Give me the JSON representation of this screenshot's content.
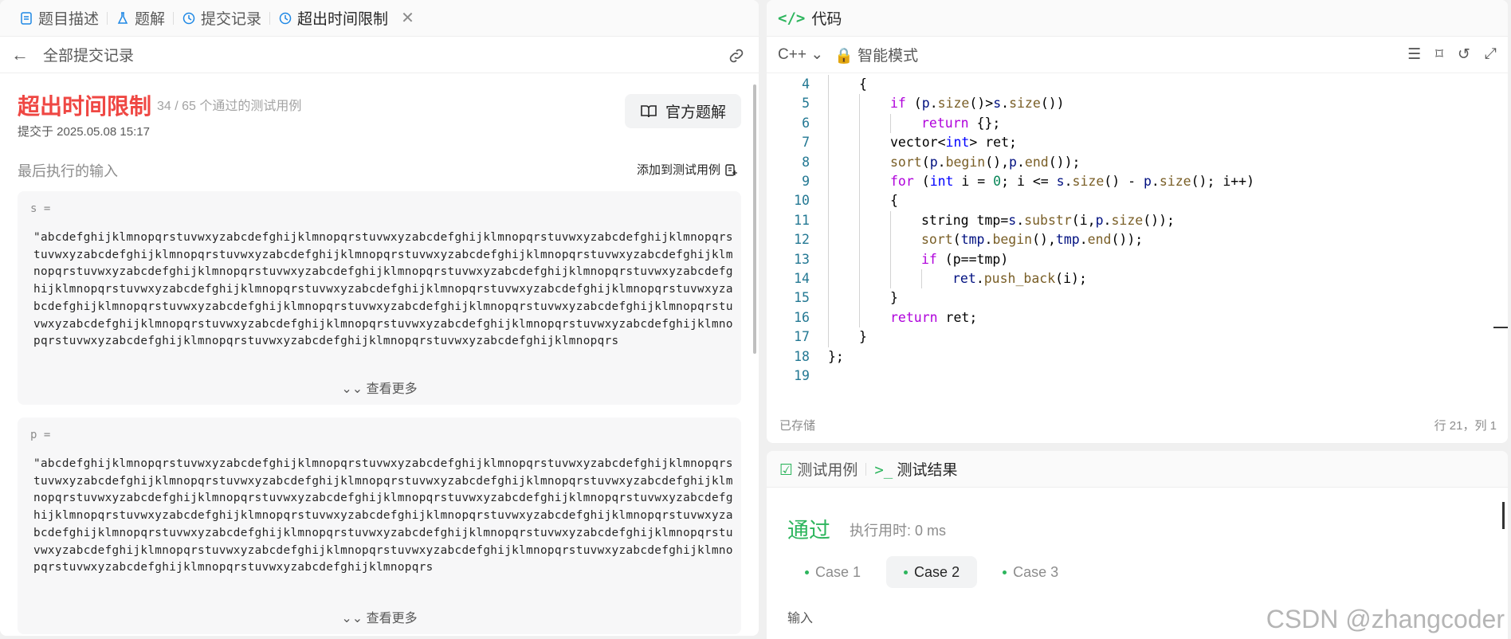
{
  "left_tabs": [
    {
      "label": "题目描述",
      "icon": "doc-icon"
    },
    {
      "label": "题解",
      "icon": "flask-icon"
    },
    {
      "label": "提交记录",
      "icon": "history-icon"
    },
    {
      "label": "超出时间限制",
      "icon": "history-icon",
      "closable": true
    }
  ],
  "subheader": {
    "back_label": "全部提交记录"
  },
  "result": {
    "status": "超出时间限制",
    "passed": "34 / 65 个通过的测试用例",
    "submitted": "提交于 2025.05.08 15:17",
    "official_solution": "官方题解",
    "last_input_label": "最后执行的输入",
    "add_to_tests": "添加到测试用例",
    "status_color": "#ef4743"
  },
  "inputs": [
    {
      "name": "s =",
      "value": "\"abcdefghijklmnopqrstuvwxyzabcdefghijklmnopqrstuvwxyzabcdefghijklmnopqrstuvwxyzabcdefghijklmnopqrstuvwxyzabcdefghijklmnopqrstuvwxyzabcdefghijklmnopqrstuvwxyzabcdefghijklmnopqrstuvwxyzabcdefghijklmnopqrstuvwxyzabcdefghijklmnopqrstuvwxyzabcdefghijklmnopqrstuvwxyzabcdefghijklmnopqrstuvwxyzabcdefghijklmnopqrstuvwxyzabcdefghijklmnopqrstuvwxyzabcdefghijklmnopqrstuvwxyzabcdefghijklmnopqrstuvwxyzabcdefghijklmnopqrstuvwxyzabcdefghijklmnopqrstuvwxyzabcdefghijklmnopqrstuvwxyzabcdefghijklmnopqrstuvwxyzabcdefghijklmnopqrstuvwxyzabcdefghijklmnopqrstuvwxyzabcdefghijklmnopqrstuvwxyzabcdefghijklmnopqrstuvwxyzabcdefghijklmnopqrstuvwxyzabcdefghijklmnopqrstuvwxyzabcdefghijklmnopqrs",
      "more": "查看更多"
    },
    {
      "name": "p =",
      "value": "\"abcdefghijklmnopqrstuvwxyzabcdefghijklmnopqrstuvwxyzabcdefghijklmnopqrstuvwxyzabcdefghijklmnopqrstuvwxyzabcdefghijklmnopqrstuvwxyzabcdefghijklmnopqrstuvwxyzabcdefghijklmnopqrstuvwxyzabcdefghijklmnopqrstuvwxyzabcdefghijklmnopqrstuvwxyzabcdefghijklmnopqrstuvwxyzabcdefghijklmnopqrstuvwxyzabcdefghijklmnopqrstuvwxyzabcdefghijklmnopqrstuvwxyzabcdefghijklmnopqrstuvwxyzabcdefghijklmnopqrstuvwxyzabcdefghijklmnopqrstuvwxyzabcdefghijklmnopqrstuvwxyzabcdefghijklmnopqrstuvwxyzabcdefghijklmnopqrstuvwxyzabcdefghijklmnopqrstuvwxyzabcdefghijklmnopqrstuvwxyzabcdefghijklmnopqrstuvwxyzabcdefghijklmnopqrstuvwxyzabcdefghijklmnopqrstuvwxyzabcdefghijklmnopqrs",
      "more": "查看更多"
    }
  ],
  "code_panel": {
    "title": "代码",
    "language": "C++",
    "mode": "智能模式",
    "saved": "已存储",
    "cursor": "行 21，列 1",
    "lines": [
      {
        "n": "4",
        "indent": 1,
        "html": "{"
      },
      {
        "n": "5",
        "indent": 2,
        "html": "<span class=\"kw\">if</span> (<span class=\"vr\">p</span>.<span class=\"fn\">size</span>()&gt;<span class=\"vr\">s</span>.<span class=\"fn\">size</span>())"
      },
      {
        "n": "6",
        "indent": 3,
        "html": "<span class=\"kw\">return</span> {};"
      },
      {
        "n": "7",
        "indent": 2,
        "html": "vector&lt;<span class=\"ty\">int</span>&gt; ret;"
      },
      {
        "n": "8",
        "indent": 2,
        "html": "<span class=\"fn\">sort</span>(<span class=\"vr\">p</span>.<span class=\"fn\">begin</span>(),<span class=\"vr\">p</span>.<span class=\"fn\">end</span>());"
      },
      {
        "n": "9",
        "indent": 2,
        "html": "<span class=\"kw\">for</span> (<span class=\"ty\">int</span> i = <span class=\"num\">0</span>; i &lt;= <span class=\"vr\">s</span>.<span class=\"fn\">size</span>() - <span class=\"vr\">p</span>.<span class=\"fn\">size</span>(); i++)"
      },
      {
        "n": "10",
        "indent": 2,
        "html": "{"
      },
      {
        "n": "11",
        "indent": 3,
        "html": "string tmp=<span class=\"vr\">s</span>.<span class=\"fn\">substr</span>(i,<span class=\"vr\">p</span>.<span class=\"fn\">size</span>());"
      },
      {
        "n": "12",
        "indent": 3,
        "html": "<span class=\"fn\">sort</span>(<span class=\"vr\">tmp</span>.<span class=\"fn\">begin</span>(),<span class=\"vr\">tmp</span>.<span class=\"fn\">end</span>());"
      },
      {
        "n": "13",
        "indent": 3,
        "html": "<span class=\"kw\">if</span> (p==tmp)"
      },
      {
        "n": "14",
        "indent": 4,
        "html": "<span class=\"vr\">ret</span>.<span class=\"fn\">push_back</span>(i);"
      },
      {
        "n": "15",
        "indent": 2,
        "html": "}"
      },
      {
        "n": "16",
        "indent": 2,
        "html": "<span class=\"kw\">return</span> ret;"
      },
      {
        "n": "17",
        "indent": 1,
        "html": "}"
      },
      {
        "n": "18",
        "indent": 0,
        "html": "};"
      },
      {
        "n": "19",
        "indent": 0,
        "html": ""
      }
    ]
  },
  "test_panel": {
    "tab_cases": "测试用例",
    "tab_results": "测试结果",
    "status": "通过",
    "exec_time": "执行用时: 0 ms",
    "cases": [
      "Case 1",
      "Case 2",
      "Case 3"
    ],
    "active_case": 1,
    "input_label": "输入",
    "pass_color": "#2db55d"
  },
  "watermark": "CSDN @zhangcoder"
}
